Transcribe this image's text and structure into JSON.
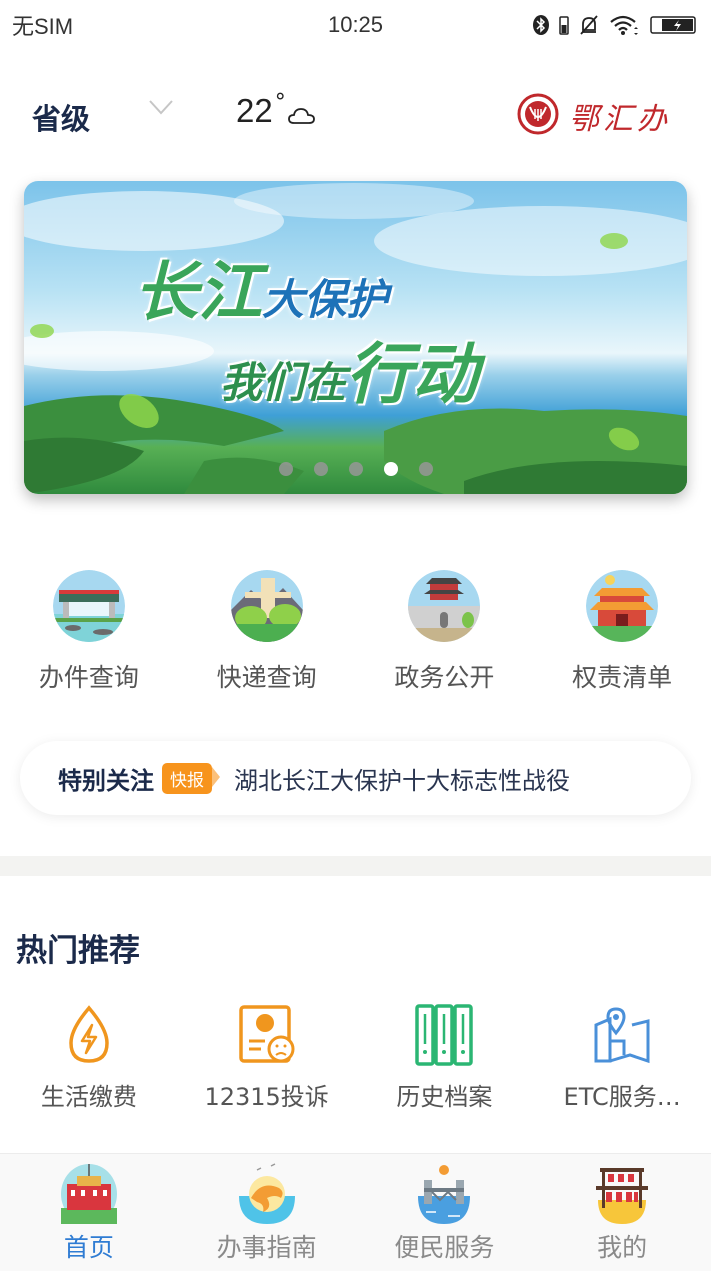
{
  "status_bar": {
    "carrier": "无SIM",
    "time": "10:25",
    "icons": [
      "bluetooth-icon",
      "vibrate-battery-icon",
      "mute-bell-icon",
      "wifi-icon",
      "battery-charging-icon"
    ]
  },
  "header": {
    "region": "省级",
    "region_dropdown_icon": "chevron-down-icon",
    "temperature": "22",
    "degree_symbol": "°",
    "weather_icon": "cloud-icon",
    "brand_name": "鄂汇办",
    "brand_logo": "harp-seal-logo"
  },
  "banner": {
    "line1_big": "长江",
    "line1_small": "大保护",
    "line2_small": "我们在",
    "line2_big": "行动",
    "slide_count": 5,
    "active_slide": 4
  },
  "quick_links": [
    {
      "label": "办件查询",
      "icon": "bridge-illustration-icon"
    },
    {
      "label": "快递查询",
      "icon": "monument-illustration-icon"
    },
    {
      "label": "政务公开",
      "icon": "gate-tower-illustration-icon"
    },
    {
      "label": "权责清单",
      "icon": "pavilion-illustration-icon"
    }
  ],
  "notice": {
    "title": "特别关注",
    "badge": "快报",
    "text": "湖北长江大保护十大标志性战役"
  },
  "hot": {
    "title": "热门推荐",
    "items": [
      {
        "label": "生活缴费",
        "icon": "water-drop-lightning-icon",
        "color": "#f0961e"
      },
      {
        "label": "12315投诉",
        "icon": "complaint-certificate-icon",
        "color": "#f0961e"
      },
      {
        "label": "历史档案",
        "icon": "archive-binders-icon",
        "color": "#2bb673"
      },
      {
        "label": "ETC服务…",
        "icon": "map-pin-icon",
        "color": "#4a90d9"
      }
    ]
  },
  "tabbar": {
    "items": [
      {
        "label": "首页",
        "icon": "home-building-icon",
        "active": true
      },
      {
        "label": "办事指南",
        "icon": "dolphin-sun-icon",
        "active": false
      },
      {
        "label": "便民服务",
        "icon": "bridge-water-icon",
        "active": false
      },
      {
        "label": "我的",
        "icon": "bell-rack-icon",
        "active": false
      }
    ]
  },
  "colors": {
    "accent": "#2f7cd3",
    "brand_red": "#c0282c",
    "badge_orange": "#f7941d",
    "title_navy": "#1b2a4a"
  }
}
